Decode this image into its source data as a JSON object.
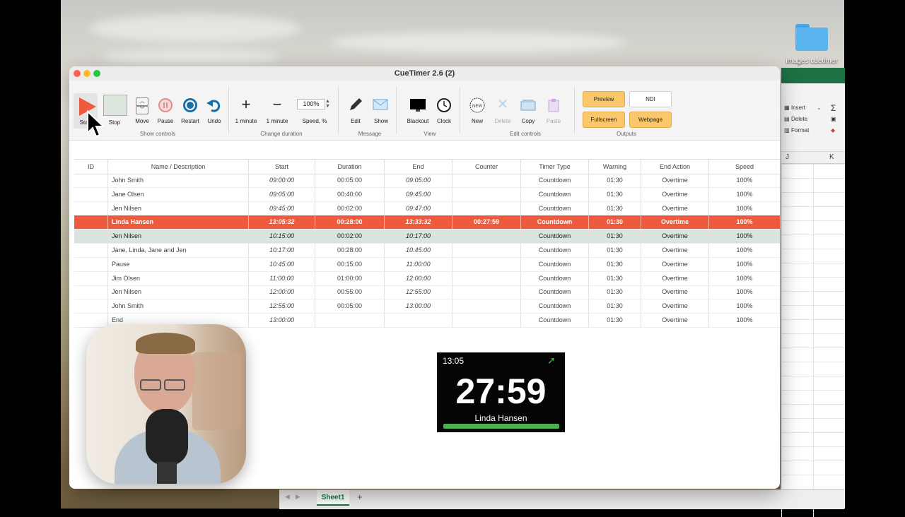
{
  "desktop": {
    "folder_label": "images cuetimer"
  },
  "window": {
    "title": "CueTimer 2.6 (2)"
  },
  "toolbar": {
    "start": "Start",
    "stop": "Stop",
    "move": "Move",
    "pause": "Pause",
    "restart": "Restart",
    "undo": "Undo",
    "show_controls": "Show controls",
    "plus_minute": "1 minute",
    "minus_minute": "1 minute",
    "speed_value": "100%",
    "speed_label": "Speed, %",
    "change_duration": "Change duration",
    "edit": "Edit",
    "show": "Show",
    "message": "Message",
    "blackout": "Blackout",
    "clock": "Clock",
    "view": "View",
    "new": "New",
    "delete": "Delete",
    "copy": "Copy",
    "paste": "Paste",
    "edit_controls": "Edit controls",
    "preview": "Preview",
    "ndi": "NDI",
    "fullscreen": "Fullscreen",
    "webpage": "Webpage",
    "outputs": "Outputs"
  },
  "table": {
    "headers": [
      "ID",
      "Name / Description",
      "Start",
      "Duration",
      "End",
      "Counter",
      "Timer Type",
      "Warning",
      "End Action",
      "Speed"
    ],
    "rows": [
      {
        "id": "",
        "name": "John Smith",
        "start": "09:00:00",
        "duration": "00:05:00",
        "end": "09:05:00",
        "counter": "",
        "type": "Countdown",
        "warning": "01:30",
        "action": "Overtime",
        "speed": "100%"
      },
      {
        "id": "",
        "name": "Jane Olsen",
        "start": "09:05:00",
        "duration": "00:40:00",
        "end": "09:45:00",
        "counter": "",
        "type": "Countdown",
        "warning": "01:30",
        "action": "Overtime",
        "speed": "100%"
      },
      {
        "id": "",
        "name": "Jen Nilsen",
        "start": "09:45:00",
        "duration": "00:02:00",
        "end": "09:47:00",
        "counter": "",
        "type": "Countdown",
        "warning": "01:30",
        "action": "Overtime",
        "speed": "100%"
      },
      {
        "id": "",
        "name": "Linda Hansen",
        "start": "13:05:32",
        "duration": "00:28:00",
        "end": "13:33:32",
        "counter": "00:27:59",
        "type": "Countdown",
        "warning": "01:30",
        "action": "Overtime",
        "speed": "100%"
      },
      {
        "id": "",
        "name": "Jen Nilsen",
        "start": "10:15:00",
        "duration": "00:02:00",
        "end": "10:17:00",
        "counter": "",
        "type": "Countdown",
        "warning": "01:30",
        "action": "Overtime",
        "speed": "100%"
      },
      {
        "id": "",
        "name": "Jane, Linda, Jane and Jen",
        "start": "10:17:00",
        "duration": "00:28:00",
        "end": "10:45:00",
        "counter": "",
        "type": "Countdown",
        "warning": "01:30",
        "action": "Overtime",
        "speed": "100%"
      },
      {
        "id": "",
        "name": "Pause",
        "start": "10:45:00",
        "duration": "00:15:00",
        "end": "11:00:00",
        "counter": "",
        "type": "Countdown",
        "warning": "01:30",
        "action": "Overtime",
        "speed": "100%"
      },
      {
        "id": "",
        "name": "Jim Olsen",
        "start": "11:00:00",
        "duration": "01:00:00",
        "end": "12:00:00",
        "counter": "",
        "type": "Countdown",
        "warning": "01:30",
        "action": "Overtime",
        "speed": "100%"
      },
      {
        "id": "",
        "name": "Jen Nilsen",
        "start": "12:00:00",
        "duration": "00:55:00",
        "end": "12:55:00",
        "counter": "",
        "type": "Countdown",
        "warning": "01:30",
        "action": "Overtime",
        "speed": "100%"
      },
      {
        "id": "",
        "name": "John Smith",
        "start": "12:55:00",
        "duration": "00:05:00",
        "end": "13:00:00",
        "counter": "",
        "type": "Countdown",
        "warning": "01:30",
        "action": "Overtime",
        "speed": "100%"
      },
      {
        "id": "",
        "name": "End",
        "start": "13:00:00",
        "duration": "",
        "end": "",
        "counter": "",
        "type": "Countdown",
        "warning": "01:30",
        "action": "Overtime",
        "speed": "100%"
      }
    ]
  },
  "timer_preview": {
    "clock": "13:05",
    "countdown": "27:59",
    "name": "Linda Hansen"
  },
  "excel": {
    "insert": "Insert",
    "delete": "Delete",
    "format": "Format",
    "col_j": "J",
    "col_k": "K",
    "sheet": "Sheet1",
    "add": "+"
  },
  "colors": {
    "accent_active": "#ee5a3e",
    "next_row": "#d8e4dc",
    "output_yellow": "#fbc76b",
    "progress_green": "#4caf50"
  }
}
